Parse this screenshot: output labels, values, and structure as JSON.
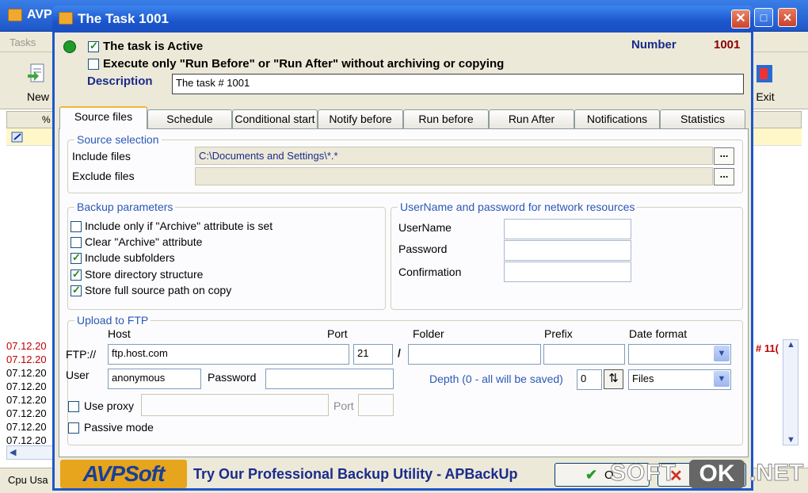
{
  "main_window": {
    "title": "AVP",
    "menu_label": "Tasks",
    "toolbar": {
      "new_label": "New",
      "exit_label": "Exit"
    },
    "grid_header_label": "%",
    "log_dates": [
      "07.12.20",
      "07.12.20",
      "07.12.20",
      "07.12.20",
      "07.12.20",
      "07.12.20",
      "07.12.20",
      "07.12.20"
    ],
    "right_log_fragment": "# 11(",
    "status_label": "Cpu Usa"
  },
  "dialog": {
    "title": "The Task 1001",
    "task_active_label": "The task is Active",
    "task_active_checked": true,
    "execute_only_label": "Execute only \"Run Before\" or \"Run After\" without archiving or copying",
    "execute_only_checked": false,
    "number_label": "Number",
    "number_value": "1001",
    "description_label": "Description",
    "description_value": "The task # 1001",
    "status_color": "#1f9b2a"
  },
  "tabs": [
    "Source files",
    "Schedule",
    "Conditional start",
    "Notify before",
    "Run before",
    "Run After",
    "Notifications",
    "Statistics"
  ],
  "source_selection": {
    "title": "Source selection",
    "include_label": "Include files",
    "include_value": "C:\\Documents and Settings\\*.*",
    "exclude_label": "Exclude files",
    "exclude_value": "",
    "browse_label": "..."
  },
  "backup_params": {
    "title": "Backup parameters",
    "options": [
      {
        "label": "Include only if \"Archive\" attribute is set",
        "checked": false
      },
      {
        "label": "Clear \"Archive\" attribute",
        "checked": false
      },
      {
        "label": "Include subfolders",
        "checked": true
      },
      {
        "label": "Store directory structure",
        "checked": true
      },
      {
        "label": "Store full source path on copy",
        "checked": true
      }
    ]
  },
  "network": {
    "title": "UserName and password for network resources",
    "username_label": "UserName",
    "password_label": "Password",
    "confirmation_label": "Confirmation"
  },
  "ftp": {
    "title": "Upload to FTP",
    "host_label": "Host",
    "port_label": "Port",
    "folder_label": "Folder",
    "prefix_label": "Prefix",
    "date_format_label": "Date format",
    "ftp_prefix": "FTP://",
    "host_value": "ftp.host.com",
    "port_value": "21",
    "separator": "/",
    "user_label": "User",
    "user_value": "anonymous",
    "password_label": "Password",
    "depth_label": "Depth (0 - all will be saved)",
    "depth_value": "0",
    "depth_unit": "Files",
    "use_proxy_label": "Use proxy",
    "proxy_port_label": "Port",
    "passive_mode_label": "Passive mode"
  },
  "banner": {
    "logo_text": "AVPSoft",
    "promo_text": "Try Our Professional Backup Utility - APBackUp",
    "ok_label": "O"
  },
  "watermark": {
    "soft": "SOFT",
    "ok": "OK",
    "net": ".NET"
  }
}
